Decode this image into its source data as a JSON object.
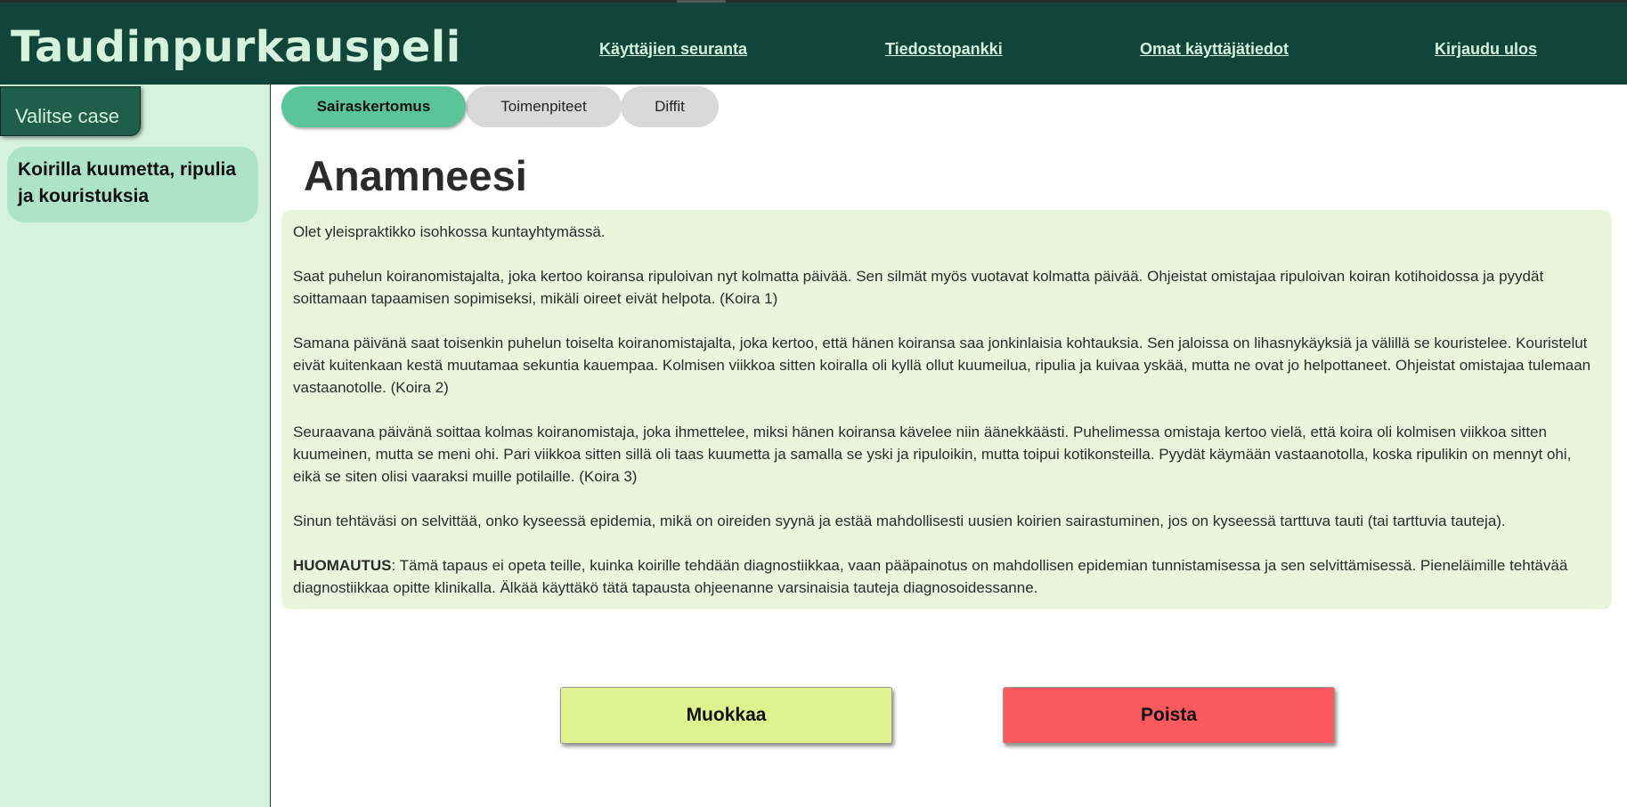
{
  "app": {
    "title": "Taudinpurkauspeli"
  },
  "nav": {
    "items": [
      {
        "label": "Käyttäjien seuranta"
      },
      {
        "label": "Tiedostopankki"
      },
      {
        "label": "Omat käyttäjätiedot"
      },
      {
        "label": "Kirjaudu ulos"
      }
    ]
  },
  "sidebar": {
    "header_label": "Valitse case",
    "cases": [
      {
        "label": "Koirilla kuumetta, ripulia ja kouristuksia"
      }
    ]
  },
  "tabs": [
    {
      "label": "Sairaskertomus",
      "active": true
    },
    {
      "label": "Toimenpiteet",
      "active": false
    },
    {
      "label": "Diffit",
      "active": false
    }
  ],
  "main": {
    "heading": "Anamneesi",
    "paragraphs": [
      "Olet yleispraktikko isohkossa kuntayhtymässä.",
      "Saat puhelun koiranomistajalta, joka kertoo koiransa ripuloivan nyt kolmatta päivää. Sen silmät myös vuotavat kolmatta päivää. Ohjeistat omistajaa ripuloivan koiran kotihoidossa ja pyydät soittamaan tapaamisen sopimiseksi, mikäli oireet eivät helpota. (Koira 1)",
      "Samana päivänä saat toisenkin puhelun toiselta koiranomistajalta, joka kertoo, että hänen koiransa saa jonkinlaisia kohtauksia. Sen jaloissa on lihasnykäyksiä ja välillä se kouristelee. Kouristelut eivät kuitenkaan kestä muutamaa sekuntia kauempaa. Kolmisen viikkoa sitten koiralla oli kyllä ollut kuumeilua, ripulia ja kuivaa yskää, mutta ne ovat jo helpottaneet. Ohjeistat omistajaa tulemaan vastaanotolle. (Koira 2)",
      "Seuraavana päivänä soittaa kolmas koiranomistaja, joka ihmettelee, miksi hänen koiransa kävelee niin äänekkäästi. Puhelimessa omistaja kertoo vielä, että koira oli kolmisen viikkoa sitten kuumeinen, mutta se meni ohi. Pari viikkoa sitten sillä oli taas kuumetta ja samalla se yski ja ripuloikin, mutta toipui kotikonsteilla. Pyydät käymään vastaanotolla, koska ripulikin on mennyt ohi, eikä se siten olisi vaaraksi muille potilaille. (Koira 3)",
      "Sinun tehtäväsi on selvittää, onko kyseessä epidemia, mikä on oireiden syynä ja estää mahdollisesti uusien koirien sairastuminen, jos on kyseessä tarttuva tauti (tai tarttuvia tauteja)."
    ],
    "note_label": "HUOMAUTUS",
    "note_text": ": Tämä tapaus ei opeta teille, kuinka koirille tehdään diagnostiikkaa, vaan pääpainotus on mahdollisen epidemian tunnistamisessa ja sen selvittämisessä. Pieneläimille tehtävää diagnostiikkaa opitte klinikalla. Älkää käyttäkö tätä tapausta ohjeenanne varsinaisia tauteja diagnosoidessanne."
  },
  "actions": {
    "edit_label": "Muokkaa",
    "delete_label": "Poista"
  },
  "colors": {
    "header_bg": "#11453a",
    "header_text": "#d4f2dd",
    "sidebar_bg": "#d4f2dd",
    "active_tab": "#5cc49a",
    "content_bg": "#e9f5dc",
    "edit_button": "#e0f28f",
    "delete_button": "#fa5a5e"
  }
}
